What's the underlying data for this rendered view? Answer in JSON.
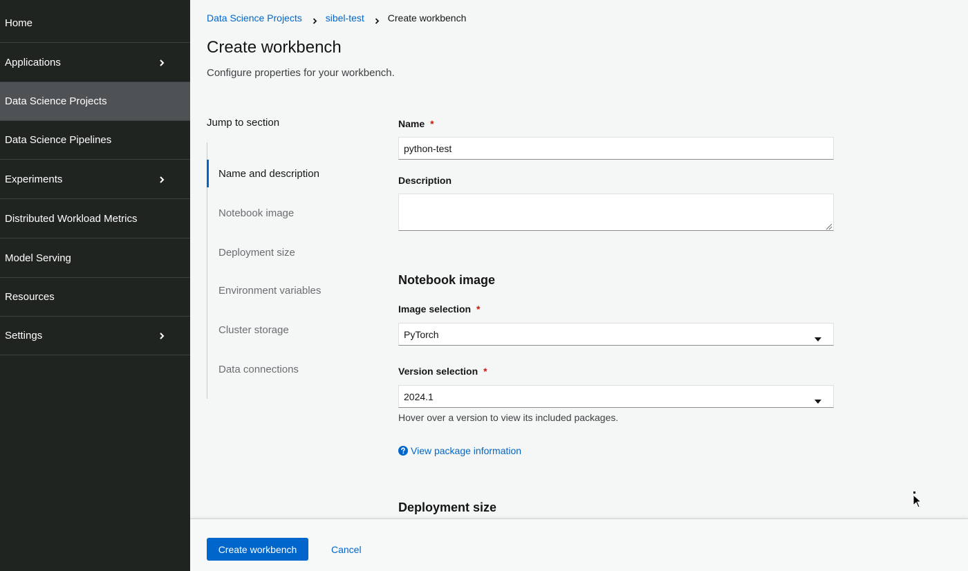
{
  "sidebar": {
    "items": [
      {
        "label": "Home",
        "has_children": false
      },
      {
        "label": "Applications",
        "has_children": true
      },
      {
        "label": "Data Science Projects",
        "has_children": false,
        "active": true
      },
      {
        "label": "Data Science Pipelines",
        "has_children": false
      },
      {
        "label": "Experiments",
        "has_children": true
      },
      {
        "label": "Distributed Workload Metrics",
        "has_children": false
      },
      {
        "label": "Model Serving",
        "has_children": false
      },
      {
        "label": "Resources",
        "has_children": false
      },
      {
        "label": "Settings",
        "has_children": true
      }
    ]
  },
  "breadcrumb": {
    "items": [
      "Data Science Projects",
      "sibel-test"
    ],
    "current": "Create workbench"
  },
  "page": {
    "title": "Create workbench",
    "description": "Configure properties for your workbench."
  },
  "jump": {
    "title": "Jump to section",
    "items": [
      "Name and description",
      "Notebook image",
      "Deployment size",
      "Environment variables",
      "Cluster storage",
      "Data connections"
    ],
    "active_index": 0
  },
  "form": {
    "name_label": "Name",
    "name_value": "python-test",
    "required_marker": "*",
    "description_label": "Description",
    "description_value": "",
    "notebook_heading": "Notebook image",
    "image_label": "Image selection",
    "image_value": "PyTorch",
    "version_label": "Version selection",
    "version_value": "2024.1",
    "version_helper": "Hover over a version to view its included packages.",
    "package_link": "View package information",
    "deployment_heading": "Deployment size"
  },
  "footer": {
    "create_label": "Create workbench",
    "cancel_label": "Cancel"
  },
  "colors": {
    "sidebar_bg": "#1f2421",
    "sidebar_active": "#4f5255",
    "link": "#0066cc",
    "primary": "#0066cc",
    "required": "#c9190b"
  }
}
